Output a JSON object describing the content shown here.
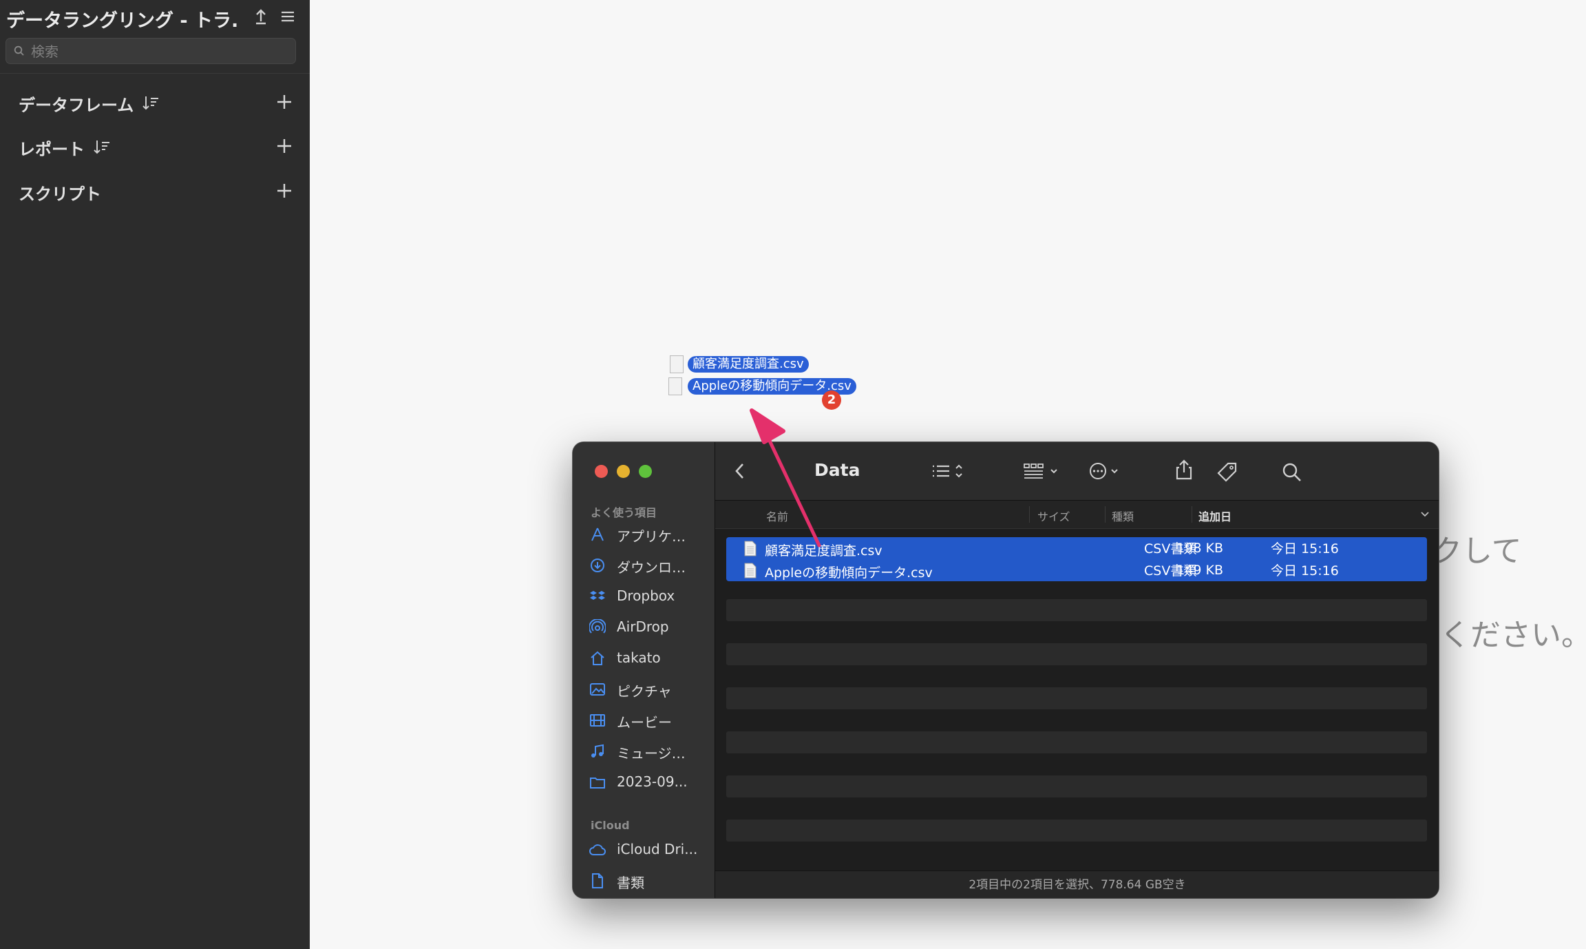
{
  "app": {
    "title": "データラングリング - トラ...",
    "search_placeholder": "検索",
    "sections": [
      {
        "label": "データフレーム"
      },
      {
        "label": "レポート"
      },
      {
        "label": "スクリプト"
      }
    ]
  },
  "background_text": {
    "line1": "クして",
    "line2": "ください。"
  },
  "drag": {
    "items": [
      "顧客満足度調査.csv",
      "Appleの移動傾向データ.csv"
    ],
    "badge": "2"
  },
  "finder": {
    "title": "Data",
    "sidebar": {
      "favorites_label": "よく使う項目",
      "favorites": [
        {
          "label": "アプリケ…",
          "icon": "applications-icon"
        },
        {
          "label": "ダウンロ…",
          "icon": "downloads-icon"
        },
        {
          "label": "Dropbox",
          "icon": "dropbox-icon"
        },
        {
          "label": "AirDrop",
          "icon": "airdrop-icon"
        },
        {
          "label": "takato",
          "icon": "home-icon"
        },
        {
          "label": "ピクチャ",
          "icon": "pictures-icon"
        },
        {
          "label": "ムービー",
          "icon": "movies-icon"
        },
        {
          "label": "ミュージ…",
          "icon": "music-icon"
        },
        {
          "label": "2023-09...",
          "icon": "folder-icon"
        }
      ],
      "icloud_label": "iCloud",
      "icloud": [
        {
          "label": "iCloud Dri...",
          "icon": "icloud-icon"
        },
        {
          "label": "書類",
          "icon": "document-icon"
        }
      ]
    },
    "columns": {
      "name": "名前",
      "size": "サイズ",
      "kind": "種類",
      "date_added": "追加日"
    },
    "files": [
      {
        "name": "顧客満足度調査.csv",
        "size": "198 KB",
        "kind": "CSV書類",
        "date_added": "今日 15:16"
      },
      {
        "name": "Appleの移動傾向データ.csv",
        "size": "149 KB",
        "kind": "CSV書類",
        "date_added": "今日 15:16"
      }
    ],
    "status": "2項目中の2項目を選択、778.64 GB空き"
  },
  "colors": {
    "selection": "#2359c9",
    "arrow": "#e4306b",
    "badge": "#e2412f"
  }
}
